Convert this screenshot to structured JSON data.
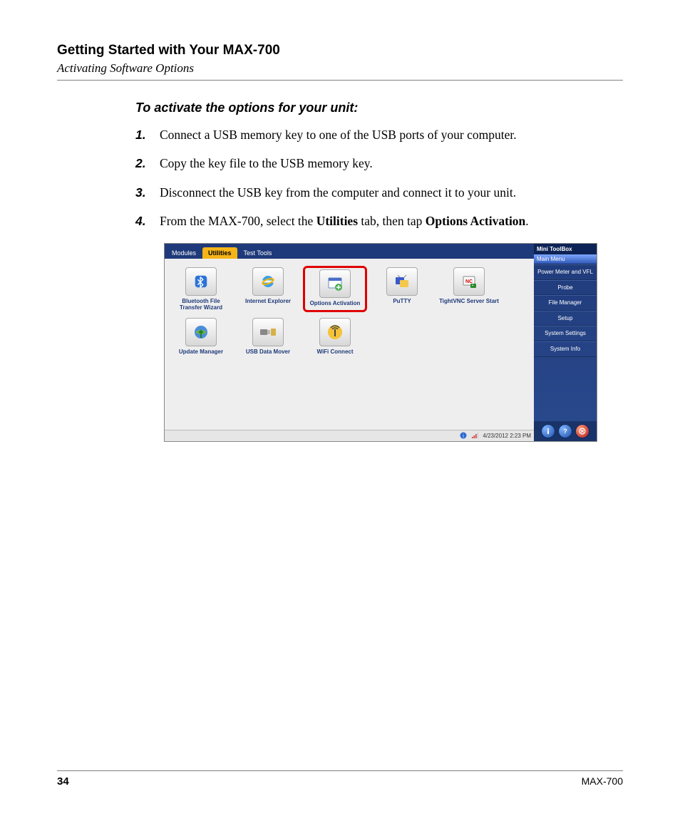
{
  "header": {
    "chapter_title": "Getting Started with Your MAX-700",
    "subtitle": "Activating Software Options"
  },
  "procedure": {
    "title": "To activate the options for your unit:",
    "steps": [
      {
        "text": "Connect a USB memory key to one of the USB ports of your computer."
      },
      {
        "text": "Copy the key file to the USB memory key."
      },
      {
        "text": "Disconnect the USB key from the computer and connect it to your unit."
      },
      {
        "prefix": "From the MAX-700, select the ",
        "bold1": "Utilities",
        "mid": " tab, then tap ",
        "bold2": "Options Activation",
        "suffix": "."
      }
    ]
  },
  "screenshot": {
    "tabs": {
      "modules": "Modules",
      "utilities": "Utilities",
      "test_tools": "Test Tools"
    },
    "utilities": [
      {
        "label": "Bluetooth File Transfer Wizard",
        "icon": "bluetooth"
      },
      {
        "label": "Internet Explorer",
        "icon": "ie"
      },
      {
        "label": "Options Activation",
        "icon": "options",
        "highlight": true
      },
      {
        "label": "PuTTY",
        "icon": "putty"
      },
      {
        "label": "TightVNC Server Start",
        "icon": "vnc"
      },
      {
        "label": "Update Manager",
        "icon": "update"
      },
      {
        "label": "USB Data Mover",
        "icon": "usb"
      },
      {
        "label": "WiFi Connect",
        "icon": "wifi"
      }
    ],
    "sidebar": {
      "title": "Mini ToolBox",
      "header": "Main Menu",
      "items": [
        "Power Meter and VFL",
        "Probe",
        "File Manager",
        "Setup",
        "System Settings",
        "System Info"
      ]
    },
    "statusbar": {
      "datetime": "4/23/2012 2:23 PM"
    }
  },
  "footer": {
    "page": "34",
    "product": "MAX-700"
  }
}
